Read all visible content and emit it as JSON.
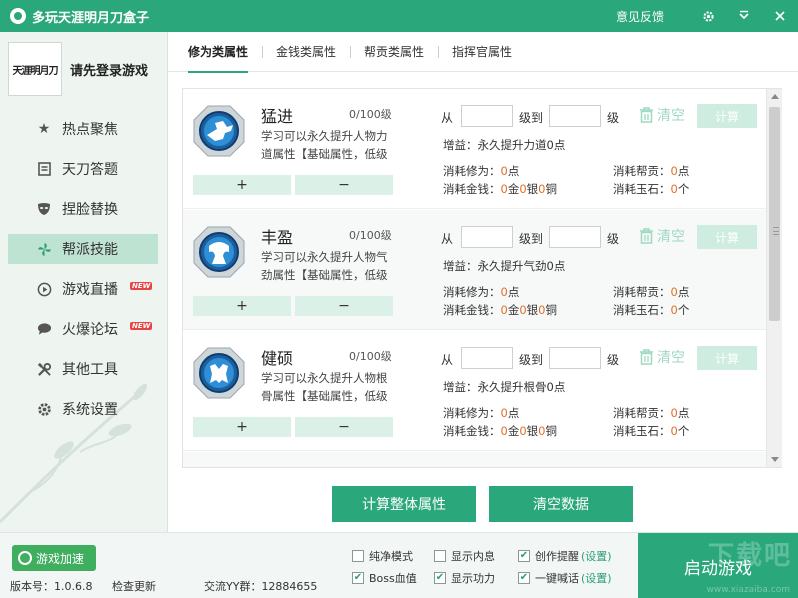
{
  "window": {
    "title": "多玩天涯明月刀盒子",
    "feedback": "意见反馈",
    "settings_icon": "gear-icon",
    "minimize_icon": "chevron-down-icon",
    "close_icon": "close-icon"
  },
  "sidebar": {
    "avatar_text": "天涯明月刀",
    "login_text": "请先登录游戏",
    "items": [
      {
        "label": "热点聚焦",
        "icon": "star-icon",
        "new": ""
      },
      {
        "label": "天刀答题",
        "icon": "notebook-icon",
        "new": ""
      },
      {
        "label": "捏脸替换",
        "icon": "mask-icon",
        "new": ""
      },
      {
        "label": "帮派技能",
        "icon": "pinwheel-icon",
        "new": ""
      },
      {
        "label": "游戏直播",
        "icon": "play-icon",
        "new": "NEW"
      },
      {
        "label": "火爆论坛",
        "icon": "chat-icon",
        "new": "NEW"
      },
      {
        "label": "其他工具",
        "icon": "tools-icon",
        "new": ""
      },
      {
        "label": "系统设置",
        "icon": "gear-icon",
        "new": ""
      }
    ]
  },
  "tabs": [
    {
      "label": "修为类属性"
    },
    {
      "label": "金钱类属性"
    },
    {
      "label": "帮贡类属性"
    },
    {
      "label": "指挥官属性"
    }
  ],
  "labels": {
    "from": "从",
    "to": "级到",
    "level": "级",
    "clear": "清空",
    "calc": "计算",
    "plus": "+",
    "minus": "−"
  },
  "skills": [
    {
      "name": "猛进",
      "level": "0/100级",
      "desc": "学习可以永久提升人物力道属性【基础属性，低级",
      "gain": "增益：永久提升力道0点",
      "cost_xiuwei_label": "消耗修为：",
      "cost_xiuwei": "0",
      "cost_xiuwei_unit": "点",
      "cost_banggong_label": "消耗帮贡：",
      "cost_banggong": "0",
      "cost_banggong_unit": "点",
      "cost_money_label": "消耗金钱：",
      "gold": "0",
      "gold_unit": "金",
      "silver": "0",
      "silver_unit": "银",
      "copper": "0",
      "copper_unit": "铜",
      "cost_jade_label": "消耗玉石：",
      "jade": "0",
      "jade_unit": "个"
    },
    {
      "name": "丰盈",
      "level": "0/100级",
      "desc": "学习可以永久提升人物气劲属性【基础属性，低级",
      "gain": "增益：永久提升气劲0点",
      "cost_xiuwei_label": "消耗修为：",
      "cost_xiuwei": "0",
      "cost_xiuwei_unit": "点",
      "cost_banggong_label": "消耗帮贡：",
      "cost_banggong": "0",
      "cost_banggong_unit": "点",
      "cost_money_label": "消耗金钱：",
      "gold": "0",
      "gold_unit": "金",
      "silver": "0",
      "silver_unit": "银",
      "copper": "0",
      "copper_unit": "铜",
      "cost_jade_label": "消耗玉石：",
      "jade": "0",
      "jade_unit": "个"
    },
    {
      "name": "健硕",
      "level": "0/100级",
      "desc": "学习可以永久提升人物根骨属性【基础属性，低级",
      "gain": "增益：永久提升根骨0点",
      "cost_xiuwei_label": "消耗修为：",
      "cost_xiuwei": "0",
      "cost_xiuwei_unit": "点",
      "cost_banggong_label": "消耗帮贡：",
      "cost_banggong": "0",
      "cost_banggong_unit": "点",
      "cost_money_label": "消耗金钱：",
      "gold": "0",
      "gold_unit": "金",
      "silver": "0",
      "silver_unit": "银",
      "copper": "0",
      "copper_unit": "铜",
      "cost_jade_label": "消耗玉石：",
      "jade": "0",
      "jade_unit": "个"
    }
  ],
  "actions": {
    "calc_all": "计算整体属性",
    "clear_data": "清空数据"
  },
  "bottom": {
    "accel": "游戏加速",
    "version": "版本号：1.0.6.8",
    "update": "检查更新",
    "qq_group": "交流YY群：12884655",
    "options": [
      {
        "label": "纯净模式",
        "checked": false,
        "link": ""
      },
      {
        "label": "显示内息",
        "checked": false,
        "link": ""
      },
      {
        "label": "创作提醒",
        "checked": true,
        "link": "(设置)"
      },
      {
        "label": "Boss血值",
        "checked": true,
        "link": ""
      },
      {
        "label": "显示功力",
        "checked": true,
        "link": ""
      },
      {
        "label": "一键喊话",
        "checked": true,
        "link": "(设置)"
      }
    ],
    "start": "启动游戏",
    "watermark": "下载吧",
    "watermark_url": "www.xiazaiba.com"
  },
  "colors": {
    "brand": "#2aa87c",
    "accent_orange": "#e0702a",
    "plus_minus_bg": "#dbf0e6"
  }
}
